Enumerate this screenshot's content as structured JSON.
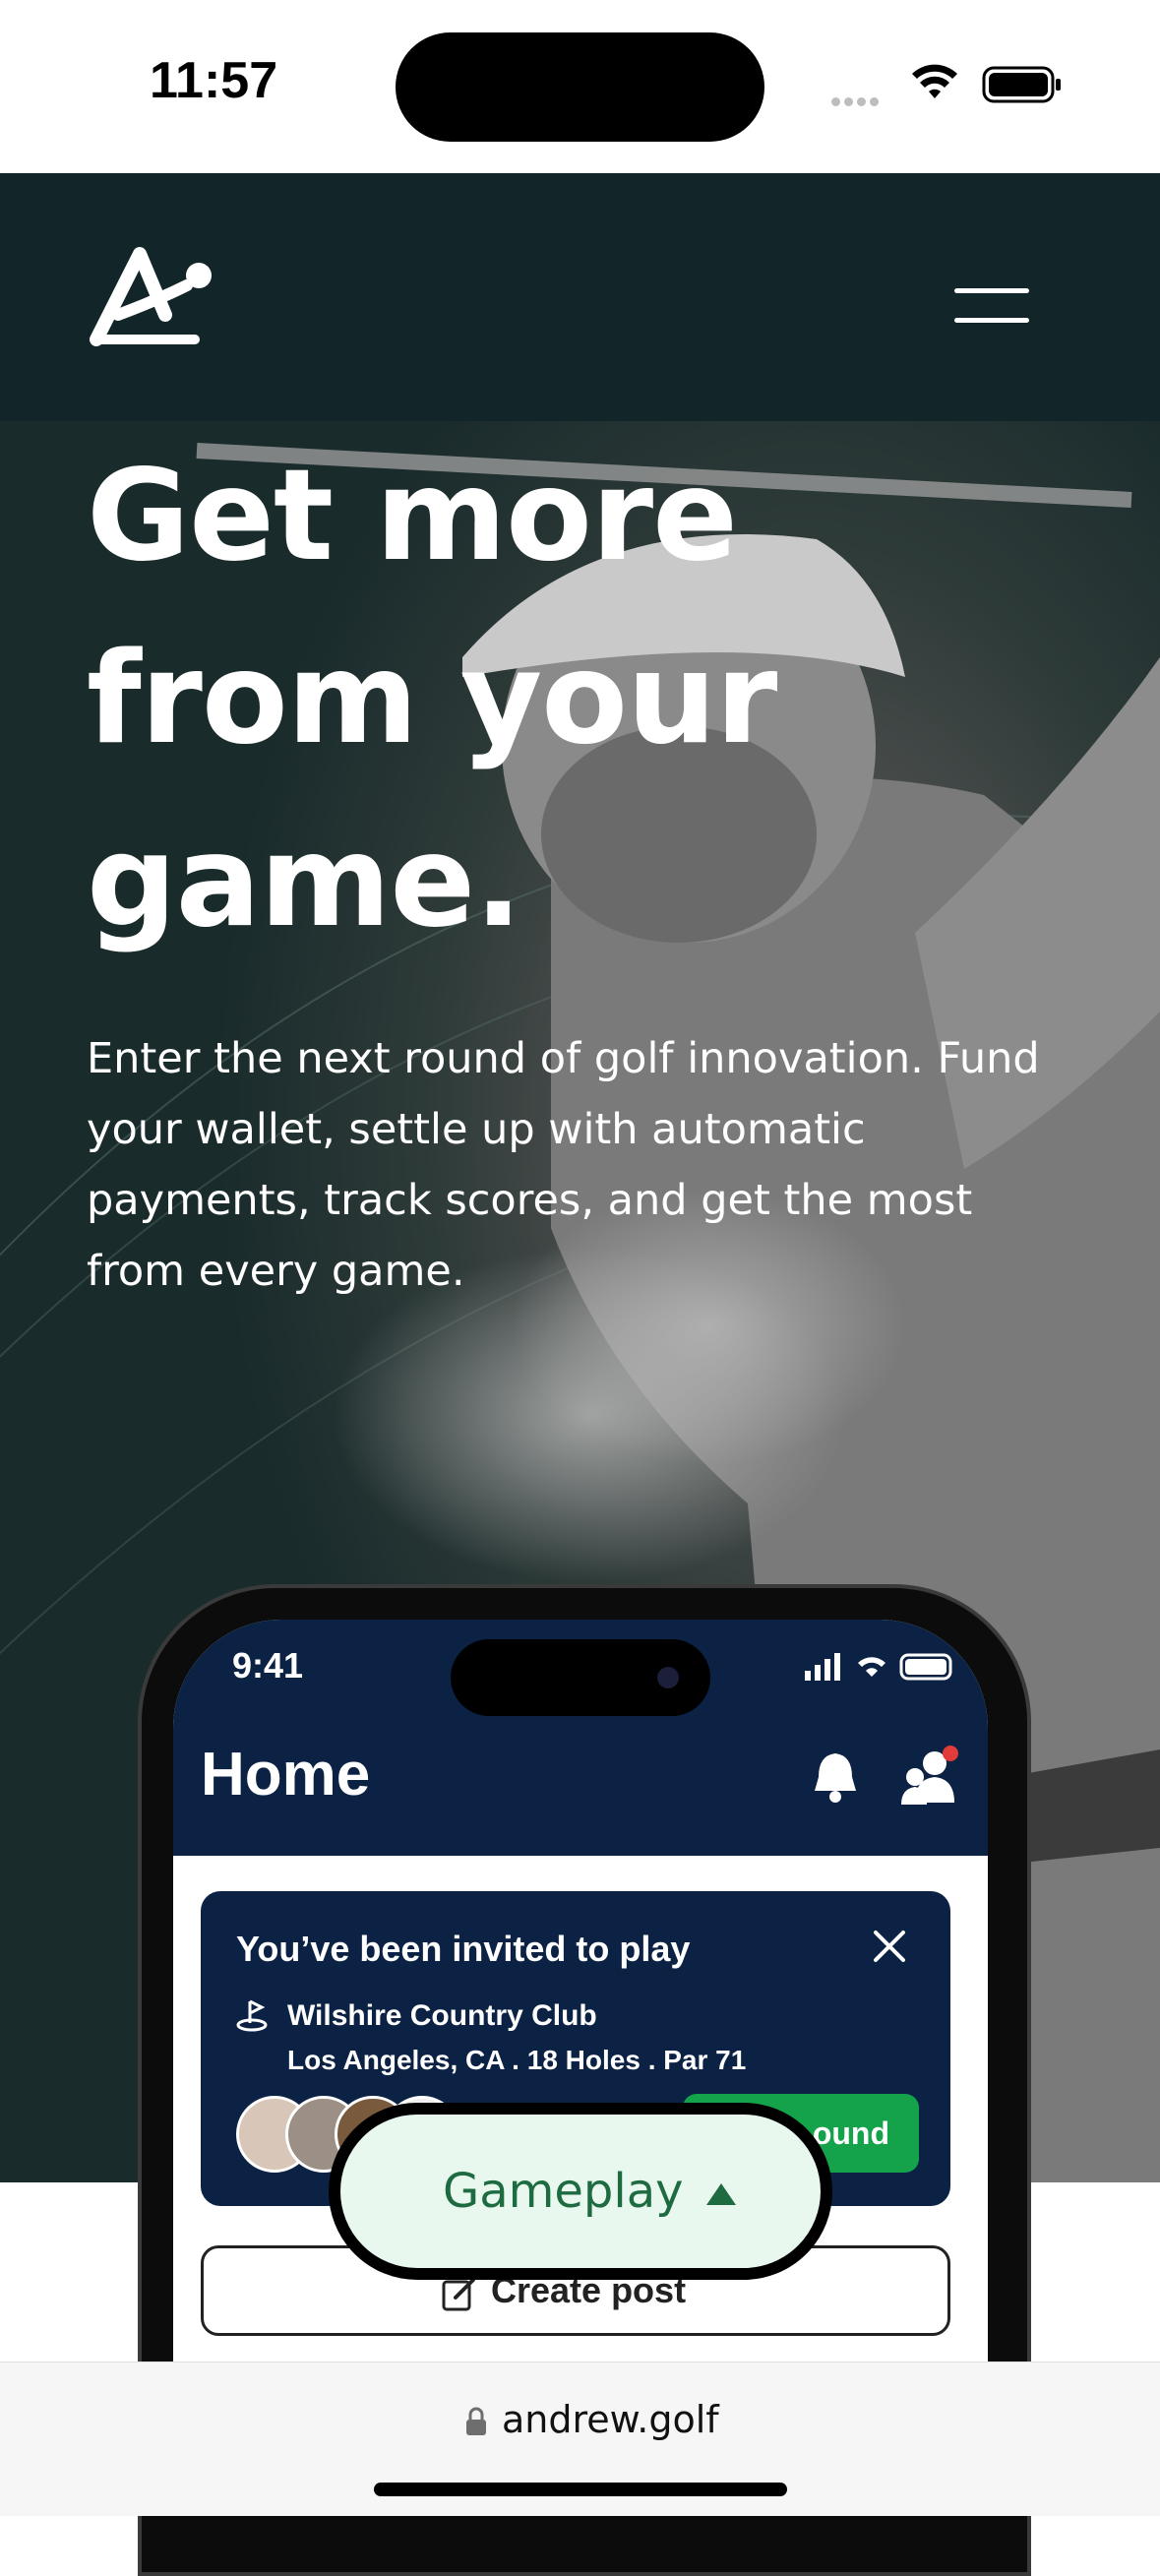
{
  "status_bar": {
    "time": "11:57"
  },
  "nav": {
    "logo_icon": "andrew-logo-icon",
    "menu_icon": "hamburger-menu-icon"
  },
  "hero": {
    "headline": "Get more from your game.",
    "subtext": "Enter the next round of golf innovation. Fund your wallet, settle up with automatic payments, track scores, and get the most from every game."
  },
  "phone": {
    "time": "9:41",
    "title": "Home",
    "invite": {
      "title": "You’ve been invited to play",
      "club": "Wilshire Country Club",
      "details": "Los Angeles, CA . 18 Holes . Par 71",
      "button": "ound"
    },
    "create_post": "Create post"
  },
  "gameplay": {
    "label": "Gameplay"
  },
  "browser": {
    "url": "andrew.golf"
  },
  "colors": {
    "nav_bg": "#12262a",
    "phone_navy": "#0b2244",
    "accent_green": "#14a34a",
    "pill_bg": "#e8f8ee",
    "pill_text": "#1f6b41"
  }
}
